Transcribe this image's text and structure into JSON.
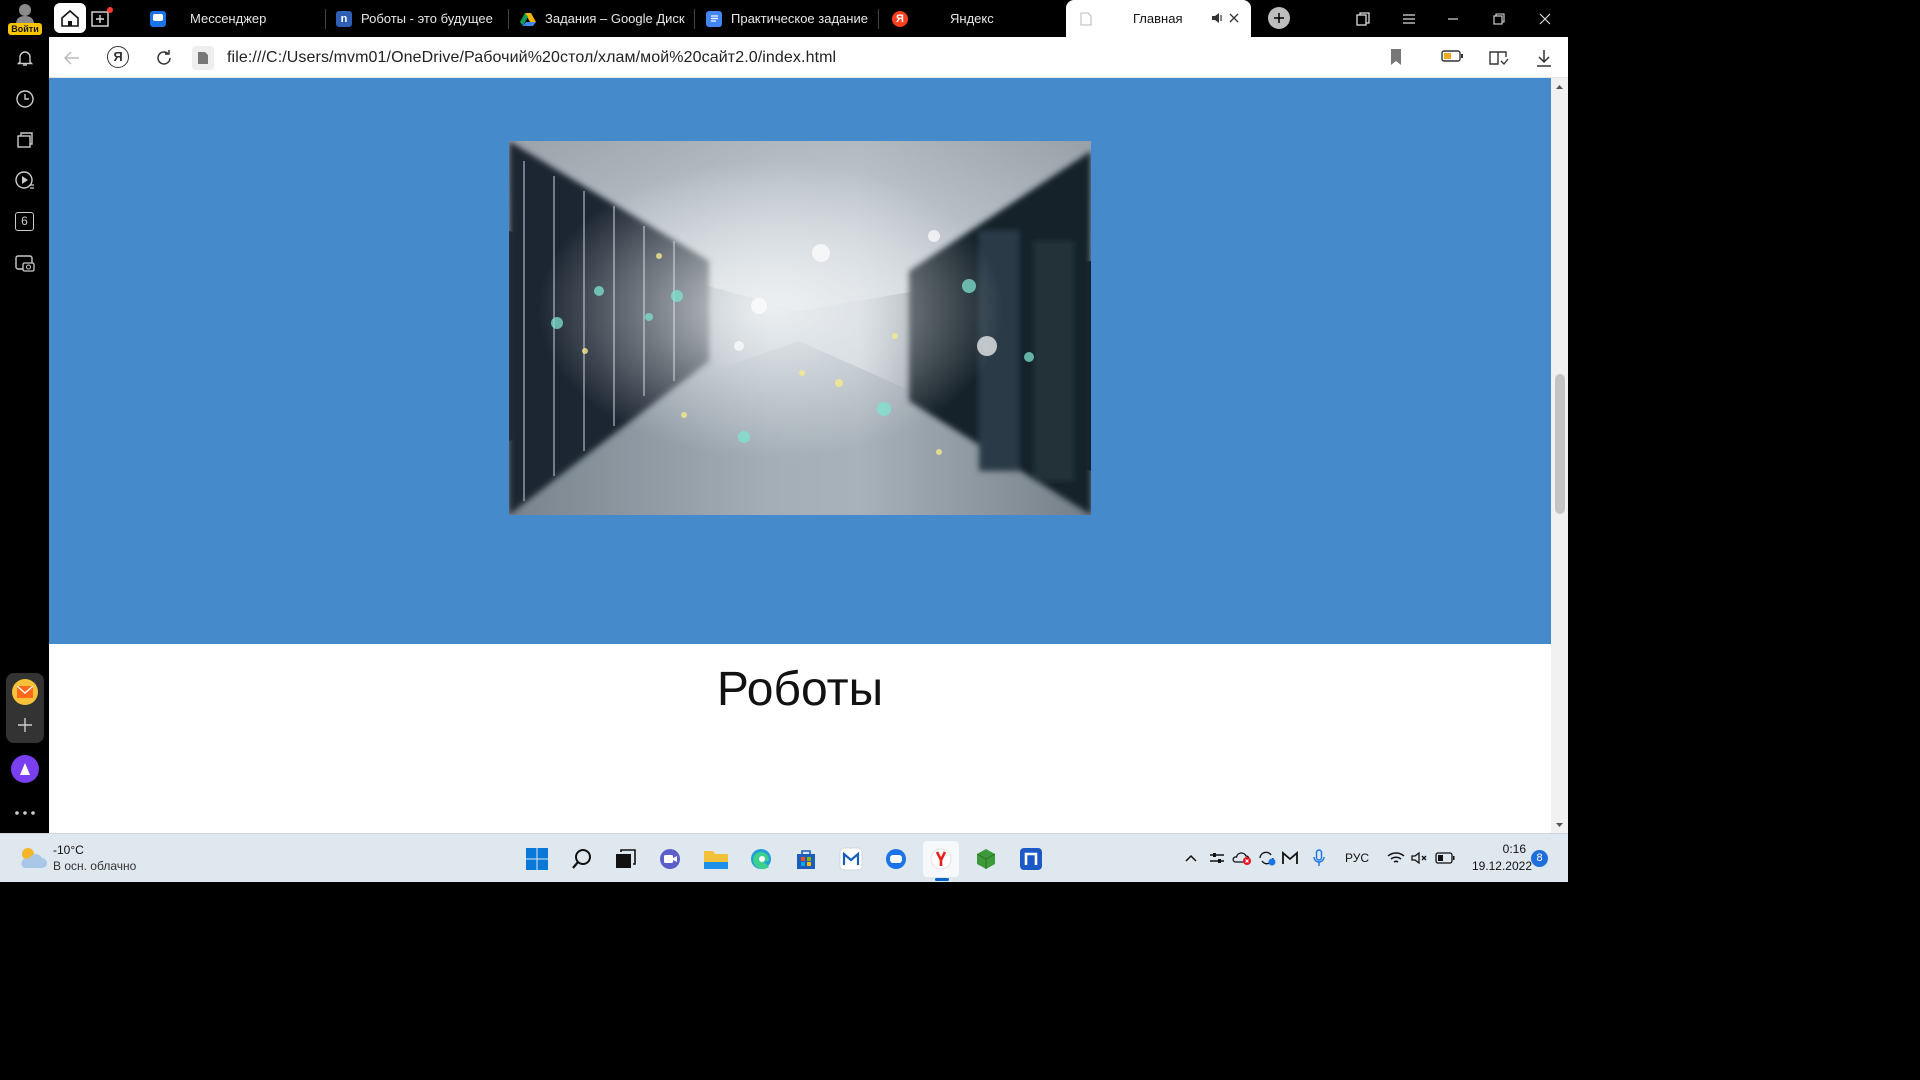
{
  "browser": {
    "tabs": [
      {
        "title": "Мессенджер",
        "fav_color": "#1a73e8"
      },
      {
        "title": "Роботы - это будущее",
        "fav_color": "#2f5eb5",
        "fav_letter": "n"
      },
      {
        "title": "Задания – Google Диск",
        "fav_color": "#1fa463"
      },
      {
        "title": "Практическое задание",
        "fav_color": "#4285f4"
      },
      {
        "title": "Яндекс",
        "fav_color": "#fc3f1d",
        "fav_letter": "Я"
      },
      {
        "title": "Главная",
        "active": true
      }
    ],
    "login_label": "Войти",
    "address": "file:///C:/Users/mvm01/OneDrive/Рабочий%20стол/хлам/мой%20сайт2.0/index.html",
    "sidebar_badge": "6"
  },
  "page": {
    "hero_color": "#458acb",
    "heading": "Роботы"
  },
  "taskbar": {
    "weather_temp": "-10°C",
    "weather_desc": "В осн. облачно",
    "language": "РУС",
    "time": "0:16",
    "date": "19.12.2022",
    "notifications": "8"
  }
}
